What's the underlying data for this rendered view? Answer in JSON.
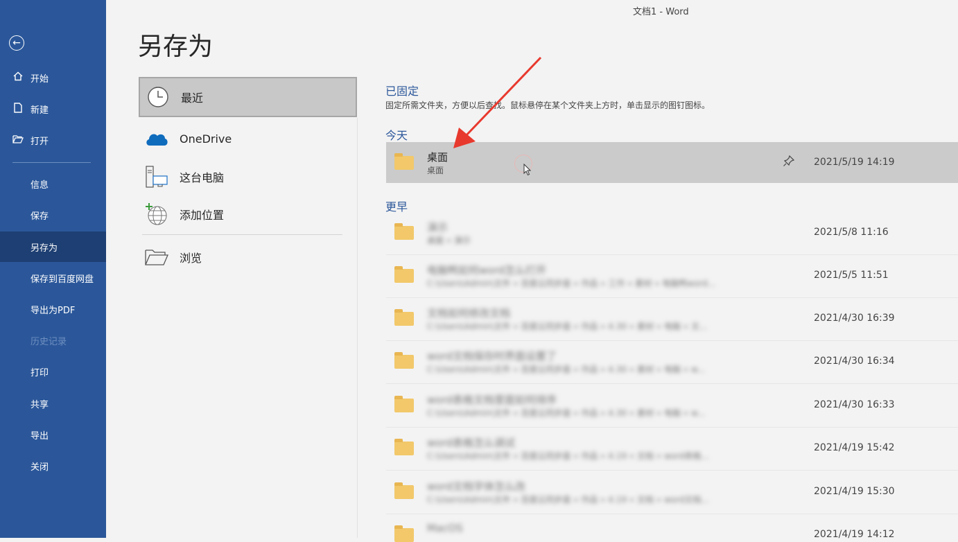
{
  "window": {
    "title": "文档1  -  Word"
  },
  "nav": {
    "back_icon": "back-arrow-icon",
    "primary": [
      {
        "label": "开始",
        "icon": "home-icon"
      },
      {
        "label": "新建",
        "icon": "new-document-icon"
      },
      {
        "label": "打开",
        "icon": "open-folder-icon"
      }
    ],
    "secondary": [
      {
        "label": "信息",
        "state": "normal"
      },
      {
        "label": "保存",
        "state": "normal"
      },
      {
        "label": "另存为",
        "state": "active"
      },
      {
        "label": "保存到百度网盘",
        "state": "normal"
      },
      {
        "label": "导出为PDF",
        "state": "normal"
      },
      {
        "label": "历史记录",
        "state": "disabled"
      },
      {
        "label": "打印",
        "state": "normal"
      },
      {
        "label": "共享",
        "state": "normal"
      },
      {
        "label": "导出",
        "state": "normal"
      },
      {
        "label": "关闭",
        "state": "normal"
      }
    ]
  },
  "page": {
    "title": "另存为"
  },
  "locations": [
    {
      "label": "最近",
      "icon": "clock-icon",
      "selected": true
    },
    {
      "label": "OneDrive",
      "icon": "onedrive-cloud-icon"
    },
    {
      "label": "这台电脑",
      "icon": "computer-icon"
    },
    {
      "label": "添加位置",
      "icon": "add-location-globe-icon"
    },
    {
      "label": "浏览",
      "icon": "browse-folder-icon"
    }
  ],
  "pinned_section": {
    "title": "已固定",
    "description": "固定所需文件夹，方便以后查找。鼠标悬停在某个文件夹上方时，单击显示的图钉图标。"
  },
  "today_section": {
    "title": "今天",
    "items": [
      {
        "name": "桌面",
        "path": "桌面",
        "date": "2021/5/19 14:19",
        "pin_icon": "pin-icon"
      }
    ]
  },
  "earlier_section": {
    "title": "更早",
    "items": [
      {
        "name": "演示",
        "path": "桌面 » 演示",
        "date": "2021/5/8 11:16"
      },
      {
        "name": "电脑鸭如何word怎么打开",
        "path": "C:\\Users\\Admin\\文件 » 百度云同步盘 » 作品 » 工作 » 素材 » 电脑鸭word...",
        "date": "2021/5/5 11:51"
      },
      {
        "name": "文档如何修改文档",
        "path": "C:\\Users\\Admin\\文件 » 百度云同步盘 » 作品 » 4.30 » 素材 » 电脑 » 文...",
        "date": "2021/4/30 16:39"
      },
      {
        "name": "word文档保存时界面设置了",
        "path": "C:\\Users\\Admin\\文件 » 百度云同步盘 » 作品 » 4.30 » 素材 » 电脑 » w...",
        "date": "2021/4/30 16:34"
      },
      {
        "name": "word表格文档里面如何排序",
        "path": "C:\\Users\\Admin\\文件 » 百度云同步盘 » 作品 » 4.30 » 素材 » 电脑 » w...",
        "date": "2021/4/30 16:33"
      },
      {
        "name": "word表格怎么调试",
        "path": "C:\\Users\\Admin\\文件 » 百度云同步盘 » 作品 » 4.19 » 文档 » word表格...",
        "date": "2021/4/19 15:42"
      },
      {
        "name": "word文档字体怎么改",
        "path": "C:\\Users\\Admin\\文件 » 百度云同步盘 » 作品 » 4.19 » 文档 » word文档...",
        "date": "2021/4/19 15:30"
      },
      {
        "name": "MacOS",
        "path": "",
        "date": "2021/4/19 14:12"
      }
    ]
  },
  "colors": {
    "nav_bg": "#2b579a",
    "nav_active": "#1e3f73",
    "accent": "#2b579a",
    "annotation_arrow": "#e8392e"
  }
}
